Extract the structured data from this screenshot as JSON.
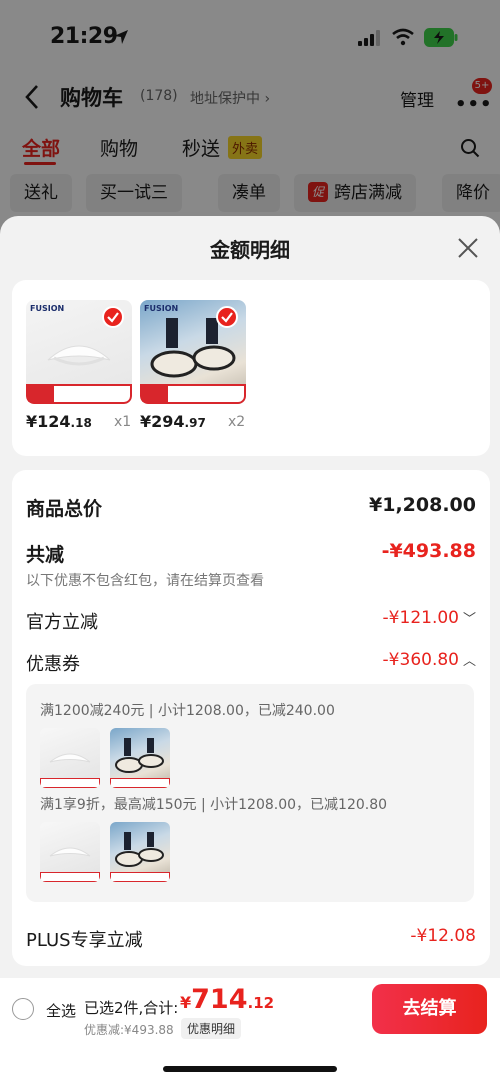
{
  "status": {
    "time": "21:29"
  },
  "nav": {
    "title": "购物车",
    "count": "(178)",
    "address_protect": "地址保护中 ›",
    "manage": "管理",
    "badge": "5+"
  },
  "tabs": [
    {
      "label": "全部"
    },
    {
      "label": "购物"
    },
    {
      "label": "秒送"
    }
  ],
  "tab_tag": "外卖",
  "chips": [
    {
      "label": "送礼"
    },
    {
      "label": "买一试三"
    },
    {
      "label": "凑单"
    },
    {
      "label": "跨店满减",
      "icon_label": "促"
    },
    {
      "label": "降价"
    }
  ],
  "sheet": {
    "title": "金额明细",
    "products": [
      {
        "brand": "FUSION",
        "price_int": "¥124",
        "price_dec": ".18",
        "qty": "x1"
      },
      {
        "brand": "FUSION",
        "price_int": "¥294",
        "price_dec": ".97",
        "qty": "x2"
      }
    ],
    "total_label": "商品总价",
    "total_value": "¥1,208.00",
    "reduce_label": "共减",
    "reduce_value": "-¥493.88",
    "reduce_note": "以下优惠不包含红包，请在结算页查看",
    "official_label": "官方立减",
    "official_value": "-¥121.00",
    "coupon_label": "优惠券",
    "coupon_value": "-¥360.80",
    "coupon_lines": [
      "满1200减240元 | 小计1208.00，已减240.00",
      "满1享9折，最高减150元 | 小计1208.00，已减120.80"
    ],
    "plus_label": "PLUS专享立减",
    "plus_value": "-¥12.08"
  },
  "bottom": {
    "select_all": "全选",
    "selected_info": "已选2件,合计:",
    "total_cur": "¥",
    "total_int": "714",
    "total_dec": ".12",
    "discount_info": "优惠减:¥493.88",
    "discount_detail": "优惠明细",
    "checkout": "去结算"
  },
  "colors": {
    "accent": "#e8231e",
    "checkout": "#f2304a"
  }
}
